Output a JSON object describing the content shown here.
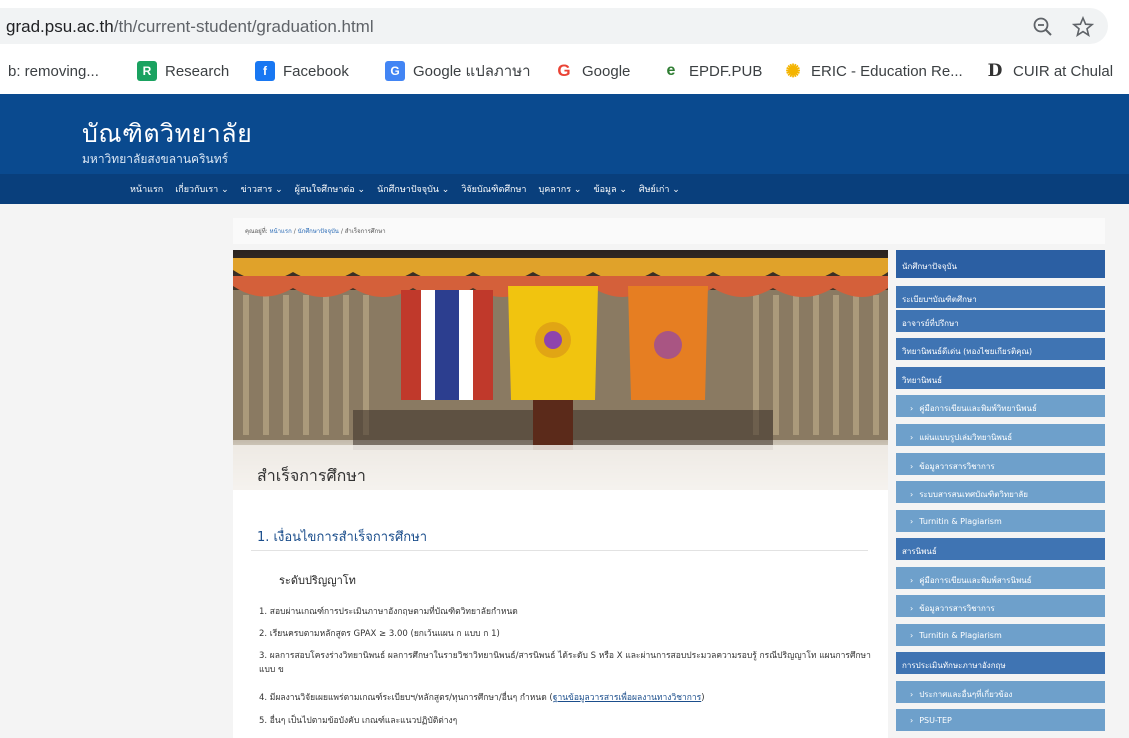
{
  "browser": {
    "url_domain": "grad.psu.ac.th",
    "url_path": "/th/current-student/graduation.html",
    "zoom_icon": "zoom-out-icon",
    "star_icon": "star-icon"
  },
  "bookmarks": [
    {
      "label": "b: removing...",
      "icon": "none"
    },
    {
      "label": "Research",
      "icon": "R",
      "color": "#1aa260"
    },
    {
      "label": "Facebook",
      "icon": "f",
      "color": "#1877f2"
    },
    {
      "label": "Google แปลภาษา",
      "icon": "G",
      "color": "#4285f4"
    },
    {
      "label": "Google",
      "icon": "G",
      "color": "#ea4335"
    },
    {
      "label": "EPDF.PUB",
      "icon": "e",
      "color": "#2e7d32"
    },
    {
      "label": "ERIC - Education Re...",
      "icon": "✺",
      "color": "#f4b400"
    },
    {
      "label": "CUIR at Chulal",
      "icon": "D",
      "color": "#333333"
    }
  ],
  "header": {
    "title": "บัณฑิตวิทยาลัย",
    "subtitle": "มหาวิทยาลัยสงขลานครินทร์",
    "nav": [
      "หน้าแรก",
      "เกี่ยวกับเรา ⌄",
      "ข่าวสาร ⌄",
      "ผู้สนใจศึกษาต่อ ⌄",
      "นักศึกษาปัจจุบัน ⌄",
      "วิจัยบัณฑิตศึกษา",
      "บุคลากร ⌄",
      "ข้อมูล ⌄",
      "ศิษย์เก่า ⌄"
    ]
  },
  "breadcrumb": {
    "prefix": "คุณอยู่ที่:",
    "home": "หน้าแรก",
    "sep": "/",
    "parent": "นักศึกษาปัจจุบัน",
    "current": "สำเร็จการศึกษา"
  },
  "main": {
    "hero_title": "สำเร็จการศึกษา",
    "section_title": "1. เงื่อนไขการสำเร็จการศึกษา",
    "level_title": "ระดับปริญญาโท",
    "conditions": [
      "1. สอบผ่านเกณฑ์การประเมินภาษาอังกฤษตามที่บัณฑิตวิทยาลัยกำหนด",
      "2. เรียนครบตามหลักสูตร GPAX ≥ 3.00 (ยกเว้นแผน ก แบบ ก 1)",
      "3. ผลการสอบโครงร่างวิทยานิพนธ์ ผลการศึกษาในรายวิชาวิทยานิพนธ์/สารนิพนธ์ ได้ระดับ S หรือ X และผ่านการสอบประมวลความรอบรู้ กรณีปริญญาโท แผนการศึกษาแบบ ข",
      "4. มีผลงานวิจัยเผยแพร่ตามเกณฑ์ระเบียบฯ/หลักสูตร/ทุนการศึกษา/อื่นๆ กำหนด (",
      "5. อื่นๆ เป็นไปตามข้อบังคับ เกณฑ์และแนวปฏิบัติต่างๆ"
    ],
    "condition4_link": "ฐานข้อมูลวารสารเพื่อผลงานทางวิชาการ",
    "condition4_tail": ")"
  },
  "sidebar": {
    "items": [
      {
        "label": "นักศึกษาปัจจุบัน",
        "kind": "head"
      },
      {
        "label": "ระเบียบฯบัณฑิตศึกษา",
        "kind": "main"
      },
      {
        "label": "อาจารย์ที่ปรึกษา",
        "kind": "main"
      },
      {
        "label": "วิทยานิพนธ์ดีเด่น (ทองไชยเกียรติคุณ)",
        "kind": "main"
      },
      {
        "label": "วิทยานิพนธ์",
        "kind": "main"
      },
      {
        "label": "คู่มือการเขียนและพิมพ์วิทยานิพนธ์",
        "kind": "sub"
      },
      {
        "label": "แผ่นแบบรูปเล่มวิทยานิพนธ์",
        "kind": "sub"
      },
      {
        "label": "ข้อมูลวารสารวิชาการ",
        "kind": "sub"
      },
      {
        "label": "ระบบสารสนเทศบัณฑิตวิทยาลัย",
        "kind": "sub"
      },
      {
        "label": "Turnitin & Plagiarism",
        "kind": "sub"
      },
      {
        "label": "สารนิพนธ์",
        "kind": "main"
      },
      {
        "label": "คู่มือการเขียนและพิมพ์สารนิพนธ์",
        "kind": "sub"
      },
      {
        "label": "ข้อมูลวารสารวิชาการ",
        "kind": "sub"
      },
      {
        "label": "Turnitin & Plagiarism",
        "kind": "sub"
      },
      {
        "label": "การประเมินทักษะภาษาอังกฤษ",
        "kind": "main"
      },
      {
        "label": "ประกาศและอื่นๆที่เกี่ยวข้อง",
        "kind": "sub"
      },
      {
        "label": "PSU-TEP",
        "kind": "sub"
      }
    ]
  }
}
